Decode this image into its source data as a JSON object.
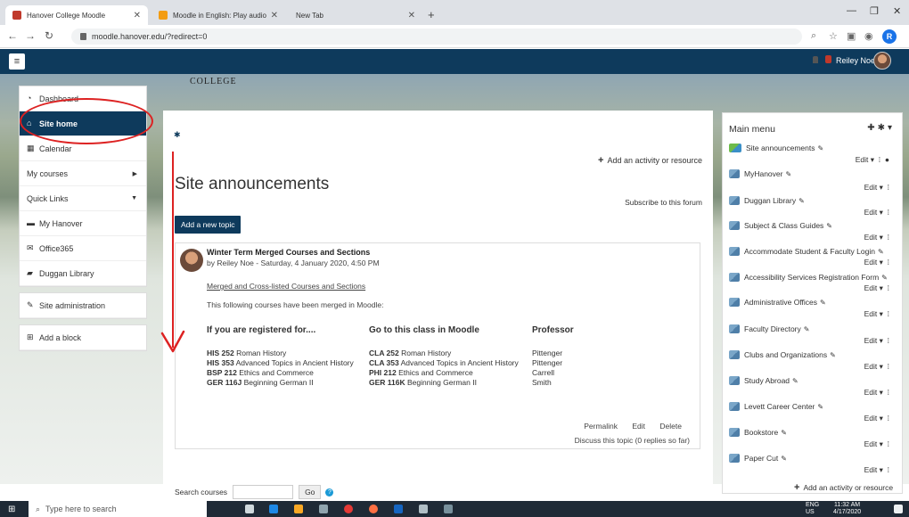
{
  "browser": {
    "tabs": [
      {
        "label": "Hanover College Moodle"
      },
      {
        "label": "Moodle in English: Play audio on"
      },
      {
        "label": "New Tab"
      }
    ],
    "url": "moodle.hanover.edu/?redirect=0"
  },
  "navbar": {
    "user_name": "Reiley Noe"
  },
  "header": {
    "college_text": "COLLEGE"
  },
  "leftnav": {
    "items": [
      {
        "label": "Dashboard",
        "icon": "dashboard-icon"
      },
      {
        "label": "Site home",
        "icon": "home-icon",
        "active": true
      },
      {
        "label": "Calendar",
        "icon": "calendar-icon"
      },
      {
        "label": "My courses",
        "expand": "right"
      },
      {
        "label": "Quick Links",
        "expand": "down"
      },
      {
        "label": "My Hanover",
        "icon": "hanover-icon"
      },
      {
        "label": "Office365",
        "icon": "mail-icon"
      },
      {
        "label": "Duggan Library",
        "icon": "book-icon"
      }
    ],
    "site_admin": "Site administration",
    "add_block": "Add a block"
  },
  "main": {
    "add_activity": "Add an activity or resource",
    "title": "Site announcements",
    "subscribe": "Subscribe to this forum",
    "new_topic": "Add a new topic",
    "post": {
      "title": "Winter Term Merged Courses and Sections",
      "byline": "by Reiley Noe - Saturday, 4 January 2020, 4:50 PM",
      "link": "Merged and Cross-listed Courses and Sections",
      "body": "This following courses have been merged in Moodle:",
      "headers": [
        "If you are registered for....",
        "Go to this class in Moodle",
        "Professor"
      ],
      "rows": [
        {
          "reg_code": "HIS 252",
          "reg_name": "Roman History",
          "go_code": "CLA 252",
          "go_name": "Roman History",
          "prof": "Pittenger"
        },
        {
          "reg_code": "HIS 353",
          "reg_name": "Advanced Topics in Ancient History",
          "go_code": "CLA 353",
          "go_name": "Advanced Topics in Ancient History",
          "prof": "Pittenger"
        },
        {
          "reg_code": "BSP 212",
          "reg_name": "Ethics and Commerce",
          "go_code": "PHI 212",
          "go_name": "Ethics and Commerce",
          "prof": "Carrell"
        },
        {
          "reg_code": "GER 116J",
          "reg_name": "Beginning German II",
          "go_code": "GER 116K",
          "go_name": "Beginning German II",
          "prof": "Smith"
        }
      ],
      "permalink": "Permalink",
      "edit": "Edit",
      "delete": "Delete",
      "discuss": "Discuss this topic (0 replies so far)"
    },
    "search_label": "Search courses",
    "search_go": "Go"
  },
  "rightmenu": {
    "title": "Main menu",
    "items": [
      "Site announcements",
      "MyHanover",
      "Duggan Library",
      "Subject & Class Guides",
      "Accommodate Student & Faculty Login",
      "Accessibility Services Registration Form",
      "Administrative Offices",
      "Faculty Directory",
      "Clubs and Organizations",
      "Study Abroad",
      "Levett Career Center",
      "Bookstore",
      "Paper Cut"
    ],
    "edit_label": "Edit",
    "add_activity": "Add an activity or resource"
  },
  "taskbar": {
    "search_placeholder": "Type here to search",
    "lang_line1": "ENG",
    "lang_line2": "US",
    "time": "11:32 AM",
    "date": "4/17/2020"
  },
  "colors": {
    "navy": "#0e3a5c",
    "annotation_red": "#d22"
  }
}
